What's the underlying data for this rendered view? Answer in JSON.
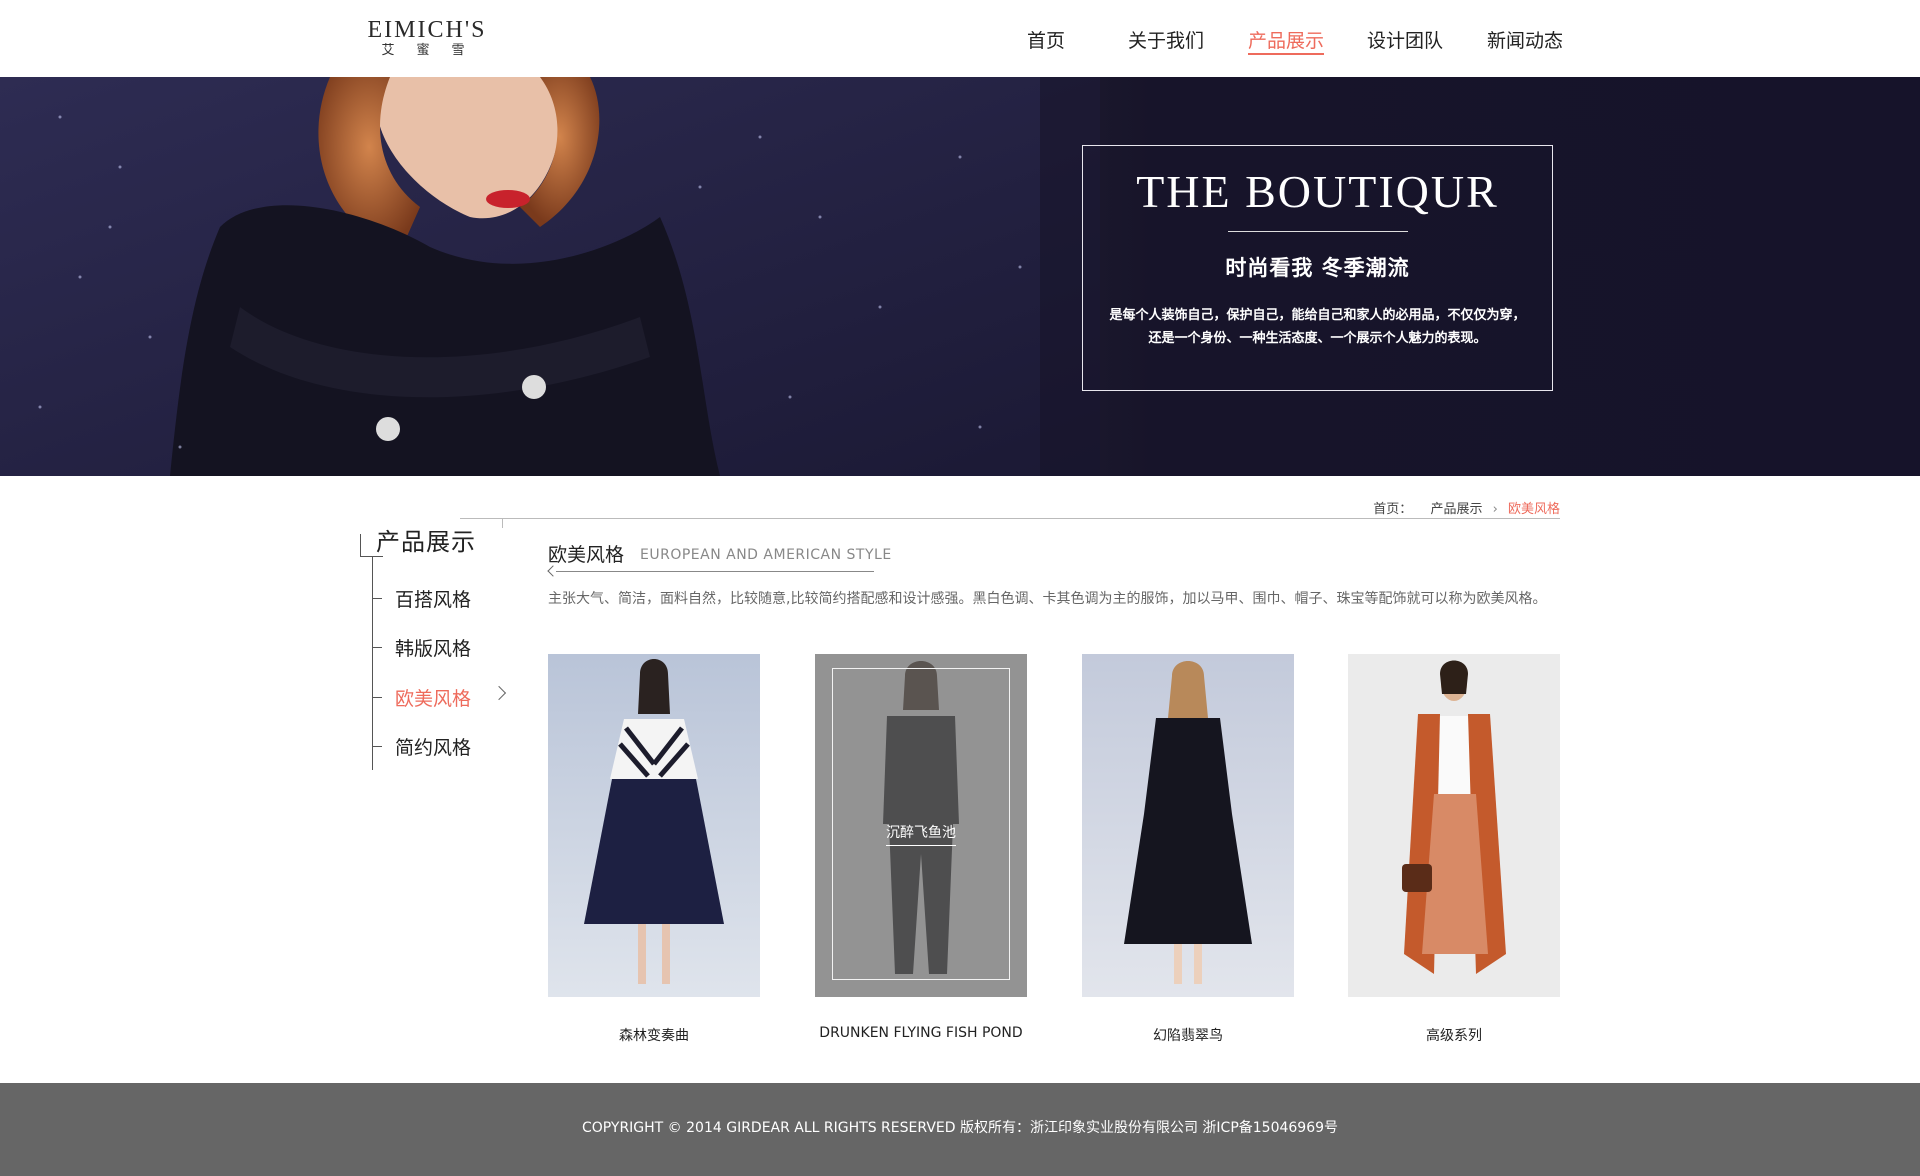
{
  "logo": {
    "en": "EIMICH'S",
    "cn": "艾蜜雪"
  },
  "nav": {
    "items": [
      "首页",
      "关于我们",
      "产品展示",
      "设计团队",
      "新闻动态"
    ],
    "active_index": 2
  },
  "banner": {
    "title": "THE BOUTIQUR",
    "subtitle": "时尚看我 冬季潮流",
    "description": "是每个人装饰自己，保护自己，能给自己和家人的必用品，不仅仅为穿，还是一个身份、一种生活态度、一个展示个人魅力的表现。"
  },
  "breadcrumb": {
    "home": "首页：",
    "level1": "产品展示",
    "current": "欧美风格"
  },
  "sidebar": {
    "title": "产品展示",
    "items": [
      "百搭风格",
      "韩版风格",
      "欧美风格",
      "简约风格"
    ],
    "active_index": 2
  },
  "section": {
    "title": "欧美风格",
    "title_en": "EUROPEAN AND AMERICAN STYLE",
    "description": "主张大气、简洁，面料自然，比较随意,比较简约搭配感和设计感强。黑白色调、卡其色调为主的服饰，加以马甲、围巾、帽子、珠宝等配饰就可以称为欧美风格。"
  },
  "products": [
    {
      "name": "森林变奏曲"
    },
    {
      "name": "DRUNKEN FLYING FISH POND",
      "overlay_label": "沉醉飞鱼池"
    },
    {
      "name": "幻陷翡翠鸟"
    },
    {
      "name": "高级系列"
    }
  ],
  "footer": {
    "text": "COPYRIGHT © 2014 GIRDEAR ALL RIGHTS RESERVED 版权所有：浙江印象实业股份有限公司  浙ICP备15046969号"
  },
  "colors": {
    "accent": "#ee6b5c",
    "banner_bg": "#17142a",
    "footer_bg": "#666666"
  }
}
